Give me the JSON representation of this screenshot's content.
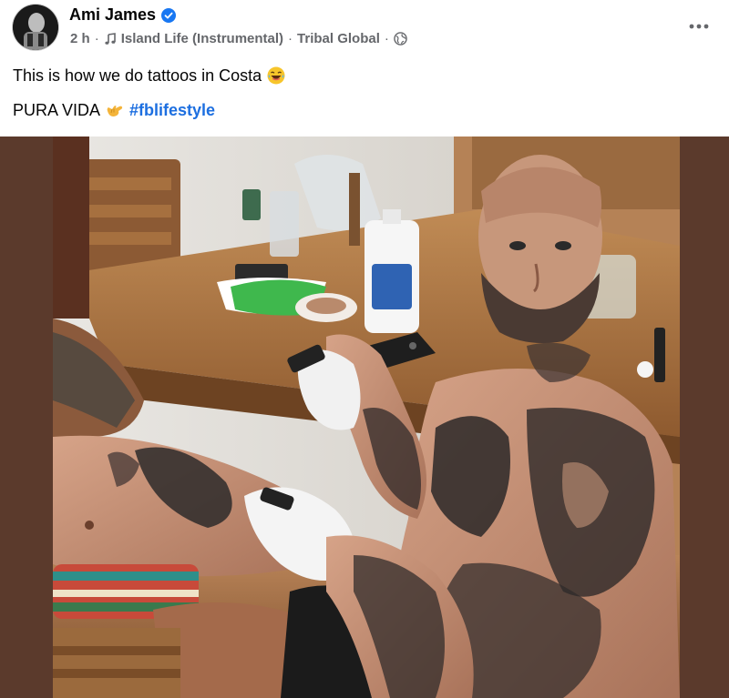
{
  "post": {
    "author": "Ami James",
    "verified": true,
    "time": "2 h",
    "separator": "·",
    "audio": "Island Life (Instrumental)",
    "audio_artist": "Tribal Global",
    "privacy_icon": "globe-icon",
    "more_icon": "more-horizontal-icon"
  },
  "content": {
    "line1_text": "This is how we do tattoos in Costa",
    "line1_emoji": "laughing-emoji",
    "line2_text": "PURA VIDA",
    "line2_emoji": "call-me-hand-emoji",
    "hashtag": "#fblifestyle"
  },
  "media": {
    "type": "photo",
    "frame_color": "#5b3a2c"
  },
  "colors": {
    "hashtag": "#1d6fe0",
    "verified": "#1877f2",
    "meta": "#65676b"
  }
}
